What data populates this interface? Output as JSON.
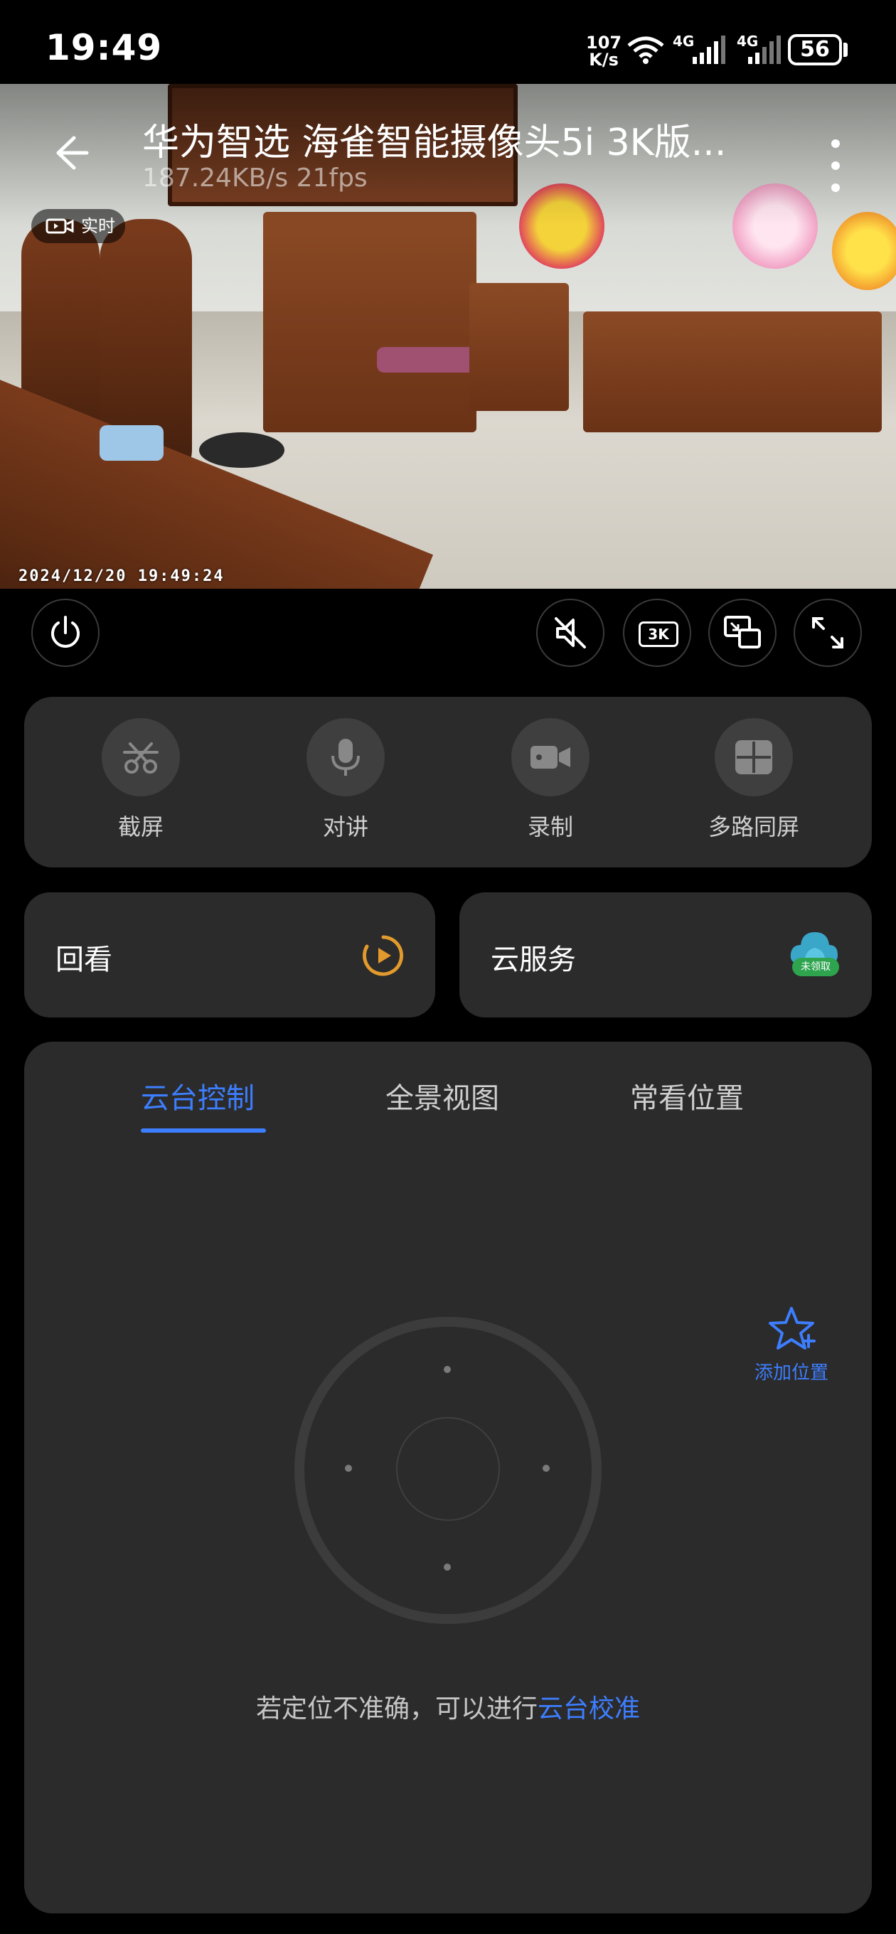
{
  "status_bar": {
    "time": "19:49",
    "net_speed_value": "107",
    "net_speed_unit": "K/s",
    "sim1_label": "4G",
    "sim2_label": "4G",
    "battery": "56"
  },
  "video": {
    "title": "华为智选 海雀智能摄像头5i 3K版...",
    "stats": "187.24KB/s   21fps",
    "live_label": "实时",
    "timestamp": "2024/12/20  19:49:24"
  },
  "controls": {
    "quality_label": "3K"
  },
  "actions": [
    {
      "label": "截屏"
    },
    {
      "label": "对讲"
    },
    {
      "label": "录制"
    },
    {
      "label": "多路同屏"
    }
  ],
  "playback": {
    "label": "回看"
  },
  "cloud": {
    "label": "云服务",
    "badge": "未领取"
  },
  "tabs": [
    {
      "label": "云台控制"
    },
    {
      "label": "全景视图"
    },
    {
      "label": "常看位置"
    }
  ],
  "add_position": {
    "label": "添加位置"
  },
  "hint": {
    "text": "若定位不准确，可以进行",
    "link": "云台校准"
  },
  "colors": {
    "accent": "#3d7eff",
    "card_bg": "#2b2b2b",
    "playback_icon": "#e39a2d",
    "cloud_badge": "#2ea44f"
  }
}
